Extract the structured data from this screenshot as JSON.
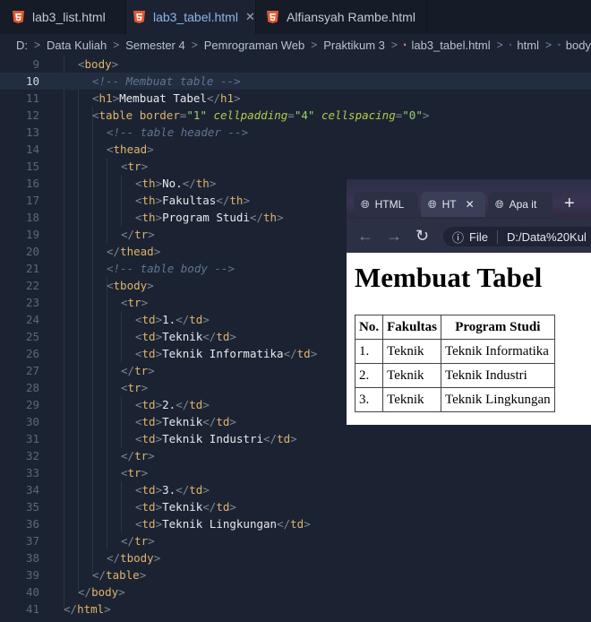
{
  "tabs": [
    {
      "label": "lab3_list.html",
      "icon": "html5-icon",
      "active": false
    },
    {
      "label": "lab3_tabel.html",
      "icon": "html5-icon",
      "active": true
    },
    {
      "label": "Alfiansyah Rambe.html",
      "icon": "html5-icon",
      "active": false
    }
  ],
  "breadcrumb": [
    "D:",
    "Data Kuliah",
    "Semester 4",
    "Pemrograman Web",
    "Praktikum 3",
    "lab3_tabel.html",
    "html",
    "body"
  ],
  "code_lines": [
    {
      "n": "9"
    },
    {
      "n": "10"
    },
    {
      "n": "11"
    },
    {
      "n": "12"
    },
    {
      "n": "13"
    },
    {
      "n": "14"
    },
    {
      "n": "15"
    },
    {
      "n": "16"
    },
    {
      "n": "17"
    },
    {
      "n": "18"
    },
    {
      "n": "19"
    },
    {
      "n": "20"
    },
    {
      "n": "21"
    },
    {
      "n": "22"
    },
    {
      "n": "23"
    },
    {
      "n": "24"
    },
    {
      "n": "25"
    },
    {
      "n": "26"
    },
    {
      "n": "27"
    },
    {
      "n": "28"
    },
    {
      "n": "29"
    },
    {
      "n": "30"
    },
    {
      "n": "31"
    },
    {
      "n": "32"
    },
    {
      "n": "33"
    },
    {
      "n": "34"
    },
    {
      "n": "35"
    },
    {
      "n": "36"
    },
    {
      "n": "37"
    },
    {
      "n": "38"
    },
    {
      "n": "39"
    },
    {
      "n": "40"
    },
    {
      "n": "41"
    }
  ],
  "code_text": {
    "body_open": "body",
    "comment_table": "<!-- Membuat table -->",
    "h1_tag": "h1",
    "h1_text": "Membuat Tabel",
    "table_tag": "table",
    "attr_border": "border",
    "val_border": "\"1\"",
    "attr_cellpadding": "cellpadding",
    "val_cellpadding": "\"4\"",
    "attr_cellspacing": "cellspacing",
    "val_cellspacing": "\"0\"",
    "comment_header": "<!-- table header -->",
    "thead": "thead",
    "tr": "tr",
    "th": "th",
    "td": "td",
    "th1": "No.",
    "th2": "Fakultas",
    "th3": "Program Studi",
    "comment_body": "<!-- table body -->",
    "tbody": "tbody",
    "r1c1": "1.",
    "r1c2": "Teknik",
    "r1c3": "Teknik Informatika",
    "r2c1": "2.",
    "r2c2": "Teknik",
    "r2c3": "Teknik Industri",
    "r3c1": "3.",
    "r3c2": "Teknik",
    "r3c3": "Teknik Lingkungan",
    "html": "html"
  },
  "browser": {
    "tabs": [
      "HTML",
      "HT",
      "Apa it"
    ],
    "file_label": "File",
    "url": "D:/Data%20Kul",
    "page_title": "Membuat Tabel",
    "table": {
      "headers": [
        "No.",
        "Fakultas",
        "Program Studi"
      ],
      "rows": [
        [
          "1.",
          "Teknik",
          "Teknik Informatika"
        ],
        [
          "2.",
          "Teknik",
          "Teknik Industri"
        ],
        [
          "3.",
          "Teknik",
          "Teknik Lingkungan"
        ]
      ]
    }
  },
  "colors": {
    "editor_bg": "#1b2333",
    "tag": "#e0b46a",
    "comment": "#5f7592",
    "string": "#9fcf6b"
  }
}
